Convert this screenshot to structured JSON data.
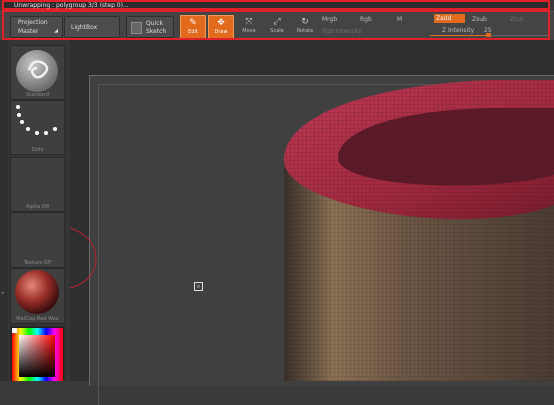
{
  "status_text": "Unwrapping : polygroup 3/3  (step 0)...",
  "projection": {
    "label": "Projection",
    "value": "Master"
  },
  "lightbox_label": "LightBox",
  "quick_sketch": {
    "line1": "Quick",
    "line2": "Sketch"
  },
  "tools": [
    {
      "name": "edit",
      "label": "Edit",
      "glyph": "✎",
      "active": true
    },
    {
      "name": "draw",
      "label": "Draw",
      "glyph": "✥",
      "active": true
    },
    {
      "name": "move",
      "label": "Move",
      "glyph": "⤧",
      "active": false
    },
    {
      "name": "scale",
      "label": "Scale",
      "glyph": "⤢",
      "active": false
    },
    {
      "name": "rotate",
      "label": "Rotate",
      "glyph": "↻",
      "active": false
    }
  ],
  "color_modes": {
    "mrgb": "Mrgb",
    "rgb": "Rgb",
    "m": "M"
  },
  "rgb_intensity_label": "Rgb Intensity",
  "depth_modes": {
    "zadd": "Zadd",
    "zsub": "Zsub",
    "zcut": "Zcut"
  },
  "z_intensity": {
    "label": "Z Intensity",
    "value": "25"
  },
  "tray": {
    "brush": "Standard",
    "stroke": "Dots",
    "alpha": "Alpha Off",
    "texture": "Texture Off",
    "material": "MatCap Red Wax"
  },
  "colors": {
    "accent": "#e16a1d",
    "highlight_frame": "#e0202a",
    "rim_red": "#a3283f"
  }
}
